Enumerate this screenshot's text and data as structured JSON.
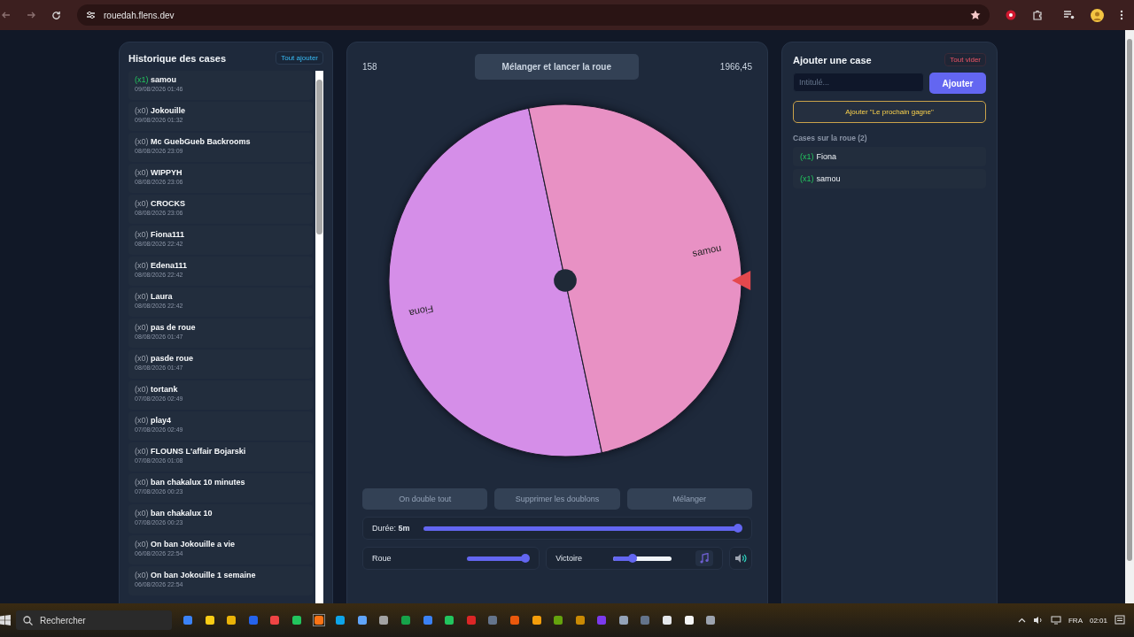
{
  "browser": {
    "url": "rouedah.flens.dev"
  },
  "history": {
    "title": "Historique des cases",
    "add_all_button": "Tout ajouter",
    "items": [
      {
        "count": "(x1)",
        "highlighted": true,
        "name": "samou",
        "date": "09/08/2026 01:46"
      },
      {
        "count": "(x0)",
        "highlighted": false,
        "name": "Jokouille",
        "date": "09/08/2026 01:32"
      },
      {
        "count": "(x0)",
        "highlighted": false,
        "name": "Mc GuebGueb Backrooms",
        "date": "08/08/2026 23:09"
      },
      {
        "count": "(x0)",
        "highlighted": false,
        "name": "WIPPYH",
        "date": "08/08/2026 23:06"
      },
      {
        "count": "(x0)",
        "highlighted": false,
        "name": "CROCKS",
        "date": "08/08/2026 23:06"
      },
      {
        "count": "(x0)",
        "highlighted": false,
        "name": "Fiona111",
        "date": "08/08/2026 22:42"
      },
      {
        "count": "(x0)",
        "highlighted": false,
        "name": "Edena111",
        "date": "08/08/2026 22:42"
      },
      {
        "count": "(x0)",
        "highlighted": false,
        "name": "Laura",
        "date": "08/08/2026 22:42"
      },
      {
        "count": "(x0)",
        "highlighted": false,
        "name": "pas de roue",
        "date": "08/08/2026 01:47"
      },
      {
        "count": "(x0)",
        "highlighted": false,
        "name": "pasde roue",
        "date": "08/08/2026 01:47"
      },
      {
        "count": "(x0)",
        "highlighted": false,
        "name": "tortank",
        "date": "07/08/2026 02:49"
      },
      {
        "count": "(x0)",
        "highlighted": false,
        "name": "play4",
        "date": "07/08/2026 02:49"
      },
      {
        "count": "(x0)",
        "highlighted": false,
        "name": "FLOUNS L'affair Bojarski",
        "date": "07/08/2026 01:08"
      },
      {
        "count": "(x0)",
        "highlighted": false,
        "name": "ban chakalux 10 minutes",
        "date": "07/08/2026 00:23"
      },
      {
        "count": "(x0)",
        "highlighted": false,
        "name": "ban chakalux 10",
        "date": "07/08/2026 00:23"
      },
      {
        "count": "(x0)",
        "highlighted": false,
        "name": "On ban Jokouille a vie",
        "date": "06/08/2026 22:54"
      },
      {
        "count": "(x0)",
        "highlighted": false,
        "name": "On ban Jokouille 1 semaine",
        "date": "06/08/2026 22:54"
      }
    ]
  },
  "wheel": {
    "left_value": "158",
    "spin_button": "Mélanger et lancer la roue",
    "right_value": "1966,45",
    "segments": [
      {
        "label": "Fiona",
        "color": "#d58ee8"
      },
      {
        "label": "samou",
        "color": "#e891c4"
      }
    ],
    "actions": [
      "On double tout",
      "Supprimer les doublons",
      "Mélanger"
    ],
    "duration": {
      "label": "Durée:",
      "value": "5m",
      "level": 1
    },
    "wheel_volume": {
      "label": "Roue",
      "level": 1
    },
    "victory_volume": {
      "label": "Victoire",
      "level": 0.33
    }
  },
  "add_panel": {
    "title": "Ajouter une case",
    "clear_button": "Tout vider",
    "input": {
      "placeholder": "Intitulé..."
    },
    "add_button": "Ajouter",
    "preset_button": "Ajouter \"Le prochain gagne\"",
    "list_title": "Cases sur la roue (2)",
    "items": [
      {
        "count": "(x1)",
        "name": "Fiona"
      },
      {
        "count": "(x1)",
        "name": "samou"
      }
    ]
  },
  "taskbar": {
    "search": {
      "placeholder": "Rechercher"
    },
    "language": "FRA",
    "time": "02:01"
  }
}
